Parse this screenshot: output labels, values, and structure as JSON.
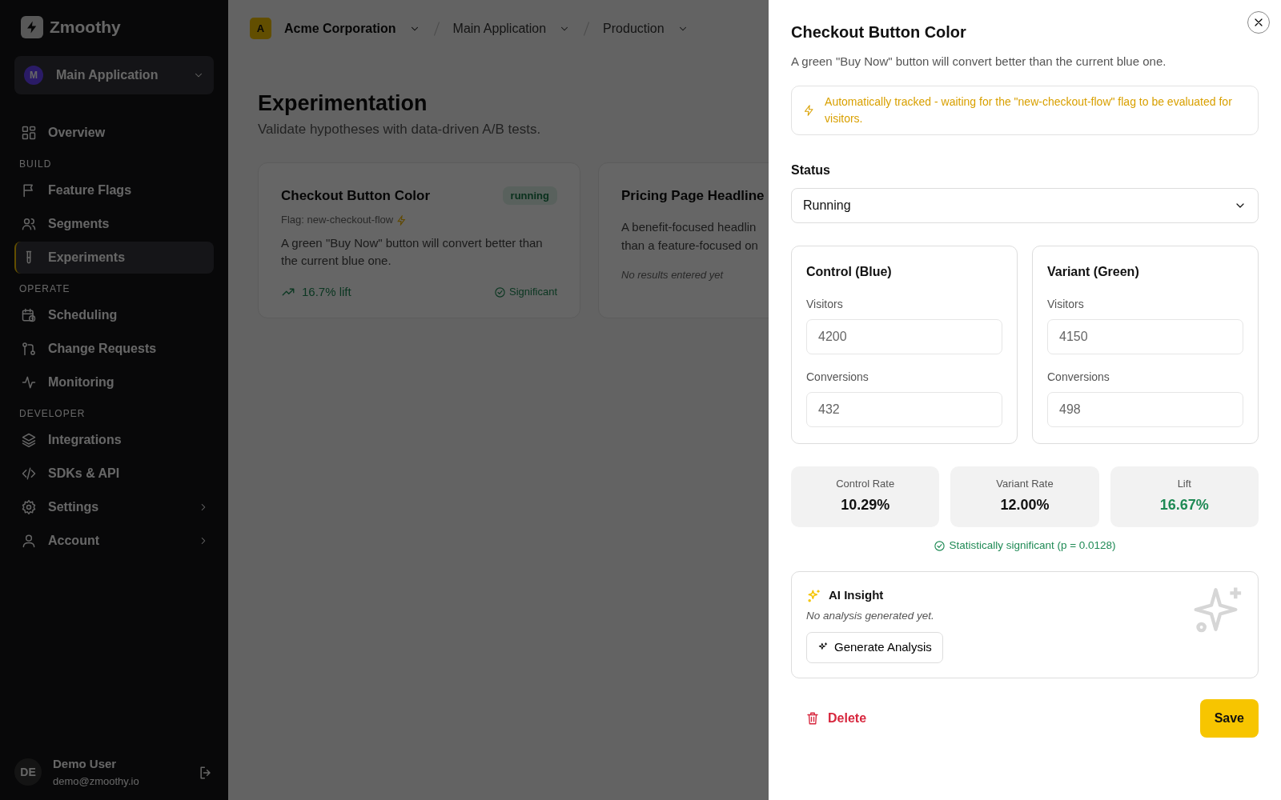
{
  "sidebar": {
    "logo": "Zmoothy",
    "app_switcher": {
      "initial": "M",
      "label": "Main Application"
    },
    "nav": [
      {
        "kind": "link",
        "label": "Overview",
        "selected": false,
        "submenu": false
      },
      {
        "kind": "heading",
        "label": "BUILD"
      },
      {
        "kind": "link",
        "label": "Feature Flags",
        "selected": false,
        "submenu": false
      },
      {
        "kind": "link",
        "label": "Segments",
        "selected": false,
        "submenu": false
      },
      {
        "kind": "link",
        "label": "Experiments",
        "selected": true,
        "submenu": false
      },
      {
        "kind": "heading",
        "label": "OPERATE"
      },
      {
        "kind": "link",
        "label": "Scheduling",
        "selected": false,
        "submenu": false
      },
      {
        "kind": "link",
        "label": "Change Requests",
        "selected": false,
        "submenu": false
      },
      {
        "kind": "link",
        "label": "Monitoring",
        "selected": false,
        "submenu": false
      },
      {
        "kind": "heading",
        "label": "DEVELOPER"
      },
      {
        "kind": "link",
        "label": "Integrations",
        "selected": false,
        "submenu": false
      },
      {
        "kind": "link",
        "label": "SDKs & API",
        "selected": false,
        "submenu": false
      },
      {
        "kind": "link",
        "label": "Settings",
        "selected": false,
        "submenu": true
      },
      {
        "kind": "link",
        "label": "Account",
        "selected": false,
        "submenu": true
      }
    ],
    "user": {
      "initials": "DE",
      "name": "Demo User",
      "email": "demo@zmoothy.io"
    }
  },
  "breadcrumb": [
    {
      "label": "Acme Corporation",
      "initial": "A",
      "selected": true
    },
    {
      "label": "Main Application",
      "selected": false
    },
    {
      "label": "Production",
      "selected": false
    }
  ],
  "page": {
    "title": "Experimentation",
    "subtitle": "Validate hypotheses with data-driven A/B tests."
  },
  "experiments": [
    {
      "title": "Checkout Button Color",
      "status": "running",
      "flag": "Flag: new-checkout-flow",
      "description": "A green \"Buy Now\" button will convert better than the current blue one.",
      "lift": "16.7% lift",
      "significance": "Significant"
    },
    {
      "title": "Pricing Page Headline",
      "description_lines": [
        "A benefit-focused headlin",
        "than a feature-focused on"
      ],
      "note": "No results entered yet"
    }
  ],
  "drawer": {
    "title": "Checkout Button Color",
    "description": "A green \"Buy Now\" button will convert better than the current blue one.",
    "alert": "Automatically tracked - waiting for the \"new-checkout-flow\" flag to be evaluated for visitors.",
    "status_label": "Status",
    "status_value": "Running",
    "groups": [
      {
        "title": "Control (Blue)",
        "fields": [
          {
            "label": "Visitors",
            "value": "4200"
          },
          {
            "label": "Conversions",
            "value": "432"
          }
        ]
      },
      {
        "title": "Variant (Green)",
        "fields": [
          {
            "label": "Visitors",
            "value": "4150"
          },
          {
            "label": "Conversions",
            "value": "498"
          }
        ]
      }
    ],
    "stats": [
      {
        "label": "Control Rate",
        "value": "10.29%",
        "positive": false
      },
      {
        "label": "Variant Rate",
        "value": "12.00%",
        "positive": false
      },
      {
        "label": "Lift",
        "value": "16.67%",
        "positive": true
      }
    ],
    "significance": "Statistically significant (p = 0.0128)",
    "ai": {
      "title": "AI Insight",
      "empty_text": "No analysis generated yet.",
      "button": "Generate Analysis"
    },
    "delete": "Delete",
    "save": "Save"
  }
}
